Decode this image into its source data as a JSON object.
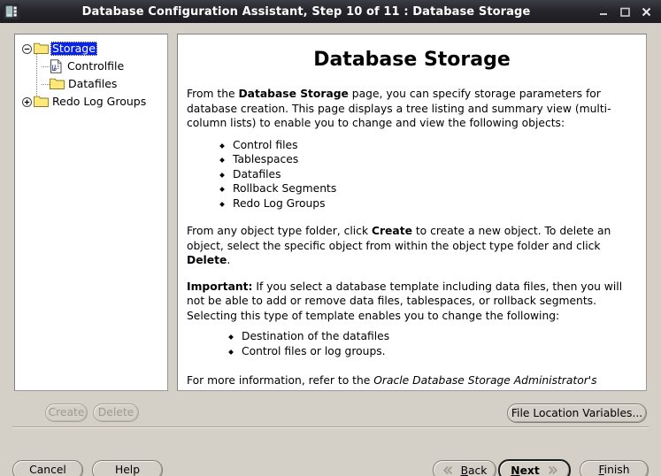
{
  "window": {
    "title": "Database Configuration Assistant, Step 10 of 11 : Database Storage",
    "app_icon": "database-app-icon",
    "controls": {
      "minimize": "minimize-icon",
      "maximize": "maximize-icon",
      "close": "close-icon"
    }
  },
  "tree": {
    "nodes": [
      {
        "label": "Storage",
        "icon": "folder-icon",
        "handle": "collapse-minus-icon",
        "selected": true,
        "depth": 0
      },
      {
        "label": "Controlfile",
        "icon": "controlfile-icon",
        "handle": "none",
        "selected": false,
        "depth": 1
      },
      {
        "label": "Datafiles",
        "icon": "folder-icon",
        "handle": "none",
        "selected": false,
        "depth": 1
      },
      {
        "label": "Redo Log Groups",
        "icon": "folder-icon",
        "handle": "expand-plus-icon",
        "selected": false,
        "depth": 1
      }
    ]
  },
  "content": {
    "heading": "Database Storage",
    "p1_a": "From the ",
    "p1_b": "Database Storage",
    "p1_c": " page, you can specify storage parameters for database creation. This page displays a tree listing and summary view (multi-column lists) to enable you to change and view the following objects:",
    "list1": [
      "Control files",
      "Tablespaces",
      "Datafiles",
      "Rollback Segments",
      "Redo Log Groups"
    ],
    "p2_a": "From any object type folder, click ",
    "p2_b": "Create",
    "p2_c": " to create a new object. To delete an object, select the specific object from within the object type folder and click ",
    "p2_d": "Delete",
    "p2_e": ".",
    "p3_a": "Important:",
    "p3_b": " If you select a database template including data files, then you will not be able to add or remove data files, tablespaces, or rollback segments. Selecting this type of template enables you to change the following:",
    "list2": [
      "Destination of the datafiles",
      "Control files or log groups."
    ],
    "p4_a": "For more information, refer to the ",
    "p4_b": "Oracle Database Storage Administrator's Guide",
    "p4_c": "."
  },
  "actions": {
    "create": "Create",
    "delete": "Delete",
    "file_location_variables": "File Location Variables..."
  },
  "navigation": {
    "cancel": "Cancel",
    "help": "Help",
    "back": "Back",
    "back_mnemonic": "B",
    "back_rest": "ack",
    "next": "Next",
    "next_mnemonic": "N",
    "next_rest": "ext",
    "finish": "Finish",
    "finish_mnemonic": "F",
    "finish_rest": "inish",
    "back_icon": "double-chevron-left-icon",
    "next_icon": "double-chevron-right-icon"
  },
  "colors": {
    "window_bg": "#d4d0c8",
    "panel_bg": "#ffffff",
    "titlebar_bg": "#25252b",
    "selection_bg": "#0a24e0",
    "folder_yellow": "#ffe87a"
  }
}
